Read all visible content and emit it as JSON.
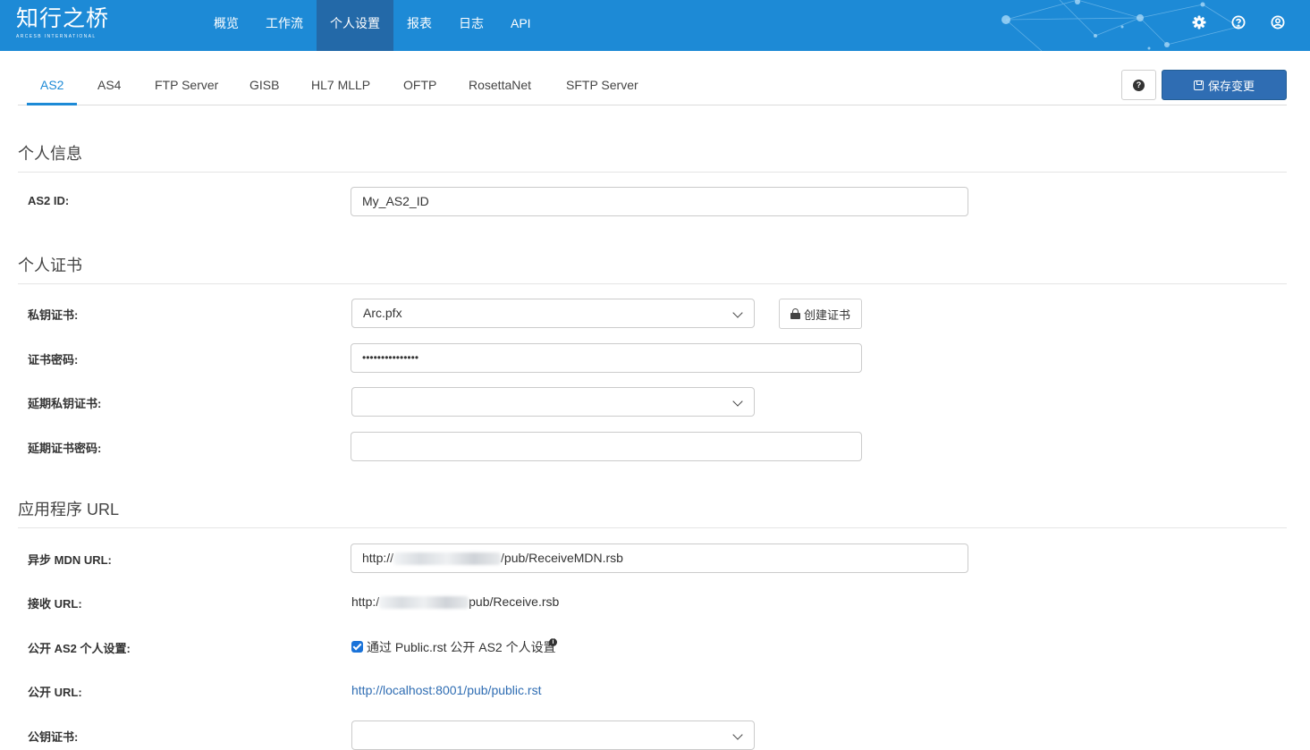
{
  "brand": {
    "name_cn": "知行之桥",
    "name_en": "ARCESB INTERNATIONAL"
  },
  "nav": {
    "items": [
      {
        "label": "概览"
      },
      {
        "label": "工作流"
      },
      {
        "label": "个人设置",
        "active": true
      },
      {
        "label": "报表"
      },
      {
        "label": "日志"
      },
      {
        "label": "API"
      }
    ],
    "icons": [
      "gear-icon",
      "help-circle-icon",
      "user-circle-icon"
    ]
  },
  "tabs": [
    {
      "label": "AS2",
      "active": true
    },
    {
      "label": "AS4"
    },
    {
      "label": "FTP Server"
    },
    {
      "label": "GISB"
    },
    {
      "label": "HL7 MLLP"
    },
    {
      "label": "OFTP"
    },
    {
      "label": "RosettaNet"
    },
    {
      "label": "SFTP Server"
    }
  ],
  "toolbar": {
    "help_icon": "?",
    "save_label": "保存变更"
  },
  "sections": {
    "personal_info": "个人信息",
    "personal_cert": "个人证书",
    "app_url": "应用程序 URL"
  },
  "form": {
    "as2_id_label": "AS2 ID:",
    "as2_id_value": "My_AS2_ID",
    "private_cert_label": "私钥证书:",
    "private_cert_value": "Arc.pfx",
    "create_cert_label": "创建证书",
    "cert_password_label": "证书密码:",
    "cert_password_value": "•••••••••••••••",
    "ext_private_cert_label": "延期私钥证书:",
    "ext_private_cert_value": "",
    "ext_cert_password_label": "延期证书密码:",
    "ext_cert_password_value": "",
    "async_mdn_label": "异步 MDN URL:",
    "async_mdn_prefix": "http://",
    "async_mdn_suffix": "/pub/ReceiveMDN.rsb",
    "receive_url_label": "接收 URL:",
    "receive_url_prefix": "http:/",
    "receive_url_suffix": "pub/Receive.rsb",
    "public_settings_label": "公开 AS2 个人设置:",
    "public_settings_checked": true,
    "public_settings_text": "通过 Public.rst 公开 AS2 个人设置",
    "public_url_label": "公开 URL:",
    "public_url_value": "http://localhost:8001/pub/public.rst",
    "public_cert_label": "公钥证书:",
    "public_cert_value": ""
  },
  "colors": {
    "topbar": "#1d8ad6",
    "nav_active": "#2369a8",
    "accent": "#1d8ad6",
    "save_button": "#2f6db3"
  }
}
